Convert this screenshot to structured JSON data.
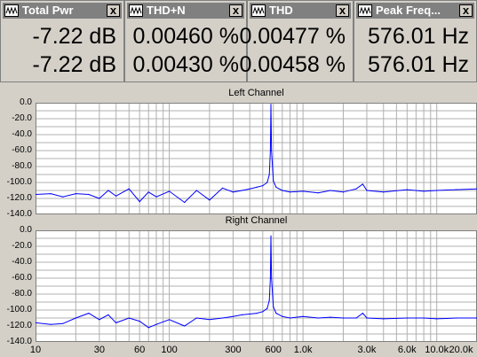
{
  "meters": [
    {
      "title": "Total Pwr",
      "values": [
        "-7.22 dB",
        "-7.22 dB"
      ]
    },
    {
      "title": "THD+N",
      "values": [
        "0.00460 %",
        "0.00430 %"
      ]
    },
    {
      "title": "THD",
      "values": [
        "0.00477 %",
        "0.00458 %"
      ]
    },
    {
      "title": "Peak Freq...",
      "values": [
        "576.01 Hz",
        "576.01 Hz"
      ]
    }
  ],
  "close_label": "x",
  "plots": [
    {
      "title": "Left Channel"
    },
    {
      "title": "Right Channel"
    }
  ],
  "y_ticks": [
    "0.0",
    "-20.0",
    "-40.0",
    "-60.0",
    "-80.0",
    "-100.0",
    "-120.0",
    "-140.0"
  ],
  "x_ticks": [
    "10",
    "30",
    "60",
    "100",
    "300",
    "600",
    "1.0k",
    "3.0k",
    "6.0k",
    "10.0k",
    "20.0k"
  ],
  "trace_color": "#0000ff",
  "chart_data": [
    {
      "type": "line",
      "title": "Left Channel",
      "x_scale": "log",
      "xlim": [
        10,
        20000
      ],
      "ylim": [
        -140,
        0
      ],
      "grid": true,
      "series": [
        {
          "x": [
            10,
            13,
            16,
            20,
            25,
            30,
            35,
            40,
            50,
            60,
            70,
            80,
            100,
            130,
            160,
            200,
            250,
            300,
            350,
            400,
            450,
            500,
            540,
            560,
            570,
            576,
            582,
            600,
            630,
            700,
            800,
            1000,
            1300,
            1600,
            2000,
            2500,
            2800,
            3000,
            4000,
            6000,
            8000,
            10000,
            14000,
            20000
          ],
          "y": [
            -115,
            -114,
            -118,
            -114,
            -115,
            -120,
            -110,
            -117,
            -108,
            -124,
            -112,
            -118,
            -111,
            -125,
            -110,
            -122,
            -107,
            -112,
            -110,
            -108,
            -106,
            -104,
            -100,
            -90,
            -60,
            -2,
            -60,
            -98,
            -106,
            -110,
            -112,
            -111,
            -113,
            -110,
            -112,
            -108,
            -102,
            -110,
            -112,
            -109,
            -111,
            -110,
            -109,
            -108
          ]
        }
      ]
    },
    {
      "type": "line",
      "title": "Right Channel",
      "x_scale": "log",
      "xlim": [
        10,
        20000
      ],
      "ylim": [
        -140,
        0
      ],
      "grid": true,
      "series": [
        {
          "x": [
            10,
            13,
            16,
            20,
            25,
            30,
            35,
            40,
            50,
            60,
            70,
            80,
            100,
            130,
            160,
            200,
            250,
            300,
            350,
            400,
            450,
            500,
            540,
            560,
            570,
            576,
            582,
            600,
            630,
            700,
            800,
            1000,
            1300,
            1600,
            2000,
            2500,
            2800,
            3000,
            4000,
            6000,
            8000,
            10000,
            14000,
            20000
          ],
          "y": [
            -116,
            -118,
            -117,
            -110,
            -104,
            -112,
            -106,
            -116,
            -110,
            -114,
            -122,
            -118,
            -112,
            -120,
            -110,
            -112,
            -110,
            -108,
            -106,
            -105,
            -104,
            -102,
            -98,
            -88,
            -60,
            -7,
            -60,
            -96,
            -104,
            -108,
            -110,
            -108,
            -110,
            -109,
            -110,
            -110,
            -104,
            -110,
            -111,
            -110,
            -110,
            -111,
            -110,
            -110
          ]
        }
      ]
    }
  ]
}
